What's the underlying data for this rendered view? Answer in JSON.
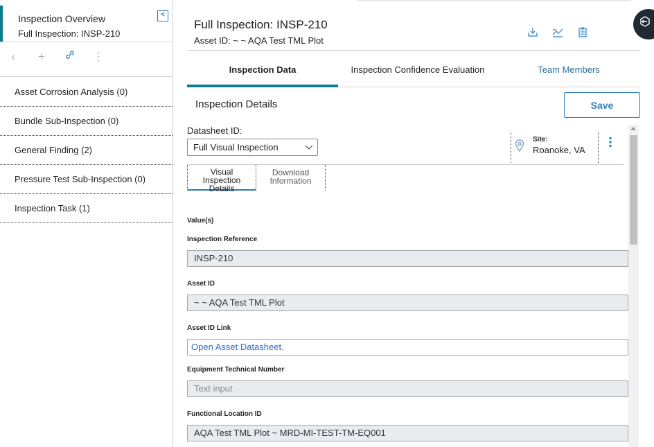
{
  "left_panel": {
    "title": "Inspection Overview",
    "subtitle": "Full Inspection: INSP-210",
    "collapse_icon": "chevron-left-icon",
    "toolbar": [
      {
        "name": "back-icon",
        "glyph": "‹"
      },
      {
        "name": "add-icon",
        "glyph": "+"
      },
      {
        "name": "link-icon",
        "glyph": "🔗"
      },
      {
        "name": "more-icon",
        "glyph": "⋮"
      }
    ],
    "items": [
      {
        "label": "Asset Corrosion Analysis (0)"
      },
      {
        "label": "Bundle Sub-Inspection (0)"
      },
      {
        "label": "General Finding (2)"
      },
      {
        "label": "Pressure Test Sub-Inspection (0)"
      },
      {
        "label": "Inspection Task (1)"
      }
    ]
  },
  "header": {
    "title": "Full Inspection: INSP-210",
    "subtitle": "Asset ID: ~ ~ AQA Test TML Plot",
    "icons": [
      "download-icon",
      "chart-icon",
      "clipboard-icon"
    ],
    "round_button_icon": "exit-icon"
  },
  "tabs": [
    {
      "label": "Inspection Data",
      "active": true
    },
    {
      "label": "Inspection Confidence Evaluation",
      "active": false
    },
    {
      "label": "Team Members",
      "active": false
    }
  ],
  "section": {
    "title": "Inspection Details",
    "save_label": "Save"
  },
  "datasheet": {
    "label": "Datasheet ID:",
    "value": "Full Visual Inspection"
  },
  "site": {
    "label": "Site:",
    "value": "Roanoke, VA"
  },
  "subtabs": [
    {
      "label_lines": [
        "Visual",
        "Inspection",
        "Details"
      ],
      "active": true
    },
    {
      "label_lines": [
        "Download",
        "Information"
      ],
      "active": false
    }
  ],
  "form": {
    "values_label": "Value(s)",
    "fields": [
      {
        "label": "Inspection Reference",
        "value": "INSP-210"
      },
      {
        "label": "Asset ID",
        "value": "~ ~ AQA Test TML Plot"
      },
      {
        "label": "Asset ID Link",
        "value": "Open Asset Datasheet."
      },
      {
        "label": "Equipment Technical Number",
        "placeholder": "Text input"
      },
      {
        "label": "Functional Location ID",
        "value": "AQA Test TML Plot ~ MRD-MI-TEST-TM-EQ001"
      }
    ]
  }
}
